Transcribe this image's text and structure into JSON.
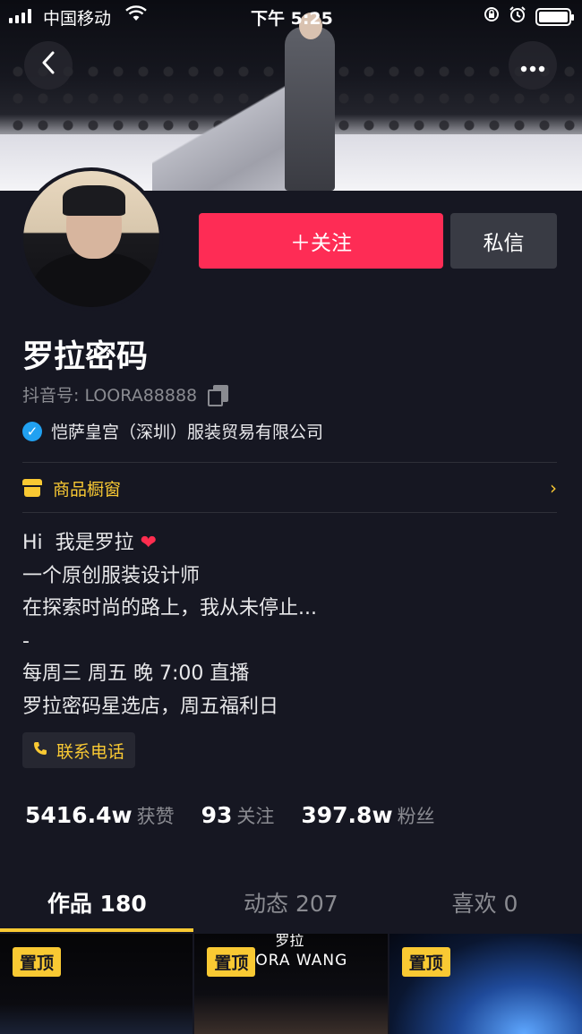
{
  "status_bar": {
    "carrier": "中国移动",
    "time": "下午 5:25"
  },
  "nav": {
    "back_icon": "chevron-left-icon",
    "more_icon": "more-dots-icon",
    "back_glyph": "‹",
    "more_glyph": "•••"
  },
  "profile": {
    "follow_label": "＋关注",
    "message_label": "私信",
    "name": "罗拉密码",
    "douyin_id": "抖音号: LOORA88888",
    "verified_text": "恺萨皇宫（深圳）服装贸易有限公司"
  },
  "shop": {
    "label": "商品橱窗",
    "chevron": "›"
  },
  "bio": {
    "line1": "Hi  我是罗拉 ",
    "heart": "❤",
    "line2": "一个原创服装设计师",
    "line3": "在探索时尚的路上，我从未停止...",
    "line4": "-",
    "line5": "每周三 周五 晚 7:00 直播",
    "line6": "罗拉密码星选店，周五福利日"
  },
  "contact": {
    "label": "联系电话",
    "icon": "phone-icon"
  },
  "stats": [
    {
      "num": "5416.4w",
      "label": "获赞"
    },
    {
      "num": "93",
      "label": "关注"
    },
    {
      "num": "397.8w",
      "label": "粉丝"
    }
  ],
  "tabs": [
    {
      "label": "作品 180"
    },
    {
      "label": "动态 207"
    },
    {
      "label": "喜欢 0"
    }
  ],
  "grid": [
    {
      "pin": "置顶",
      "caption_top": "",
      "caption": ""
    },
    {
      "pin": "置顶",
      "caption_top": "罗拉",
      "caption": "ORA WANG"
    },
    {
      "pin": "置顶",
      "caption_top": "",
      "caption": ""
    }
  ],
  "colors": {
    "accent_follow": "#fe2c55",
    "accent_yellow": "#f9c933",
    "background": "#161722"
  }
}
